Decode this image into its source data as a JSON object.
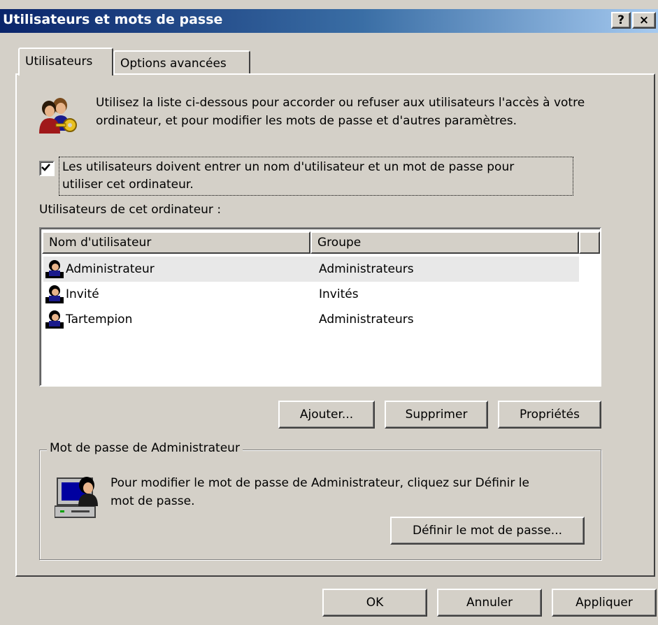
{
  "window": {
    "title": "Utilisateurs et mots de passe",
    "help_btn": "?",
    "close_btn": "×"
  },
  "tabs": [
    {
      "label": "Utilisateurs",
      "selected": true
    },
    {
      "label": "Options avancées",
      "selected": false
    }
  ],
  "intro": {
    "text": "Utilisez la liste ci-dessous pour accorder ou refuser aux utilisateurs l'accès à votre ordinateur, et pour modifier les mots de passe et d'autres paramètres."
  },
  "login_checkbox": {
    "checked": true,
    "label_line1": "Les utilisateurs doivent entrer un nom d'utilisateur et un mot de passe pour",
    "label_line2": "utiliser cet ordinateur."
  },
  "users_section": {
    "label": "Utilisateurs de cet ordinateur :",
    "columns": [
      "Nom d'utilisateur",
      "Groupe"
    ],
    "rows": [
      {
        "name": "Administrateur",
        "group": "Administrateurs",
        "selected": true
      },
      {
        "name": "Invité",
        "group": "Invités",
        "selected": false
      },
      {
        "name": "Tartempion",
        "group": "Administrateurs",
        "selected": false
      }
    ]
  },
  "list_buttons": {
    "add": "Ajouter...",
    "remove": "Supprimer",
    "properties": "Propriétés"
  },
  "password_group": {
    "legend": "Mot de passe de Administrateur",
    "text_line1": "Pour modifier le mot de passe de Administrateur, cliquez sur Définir le",
    "text_line2": "mot de passe.",
    "set_button": "Définir le mot de passe..."
  },
  "footer_buttons": {
    "ok": "OK",
    "cancel": "Annuler",
    "apply": "Appliquer"
  },
  "colors": {
    "face": "#d4d0c8",
    "title_gradient_start": "#0a246a",
    "title_gradient_end": "#a6caf0"
  }
}
